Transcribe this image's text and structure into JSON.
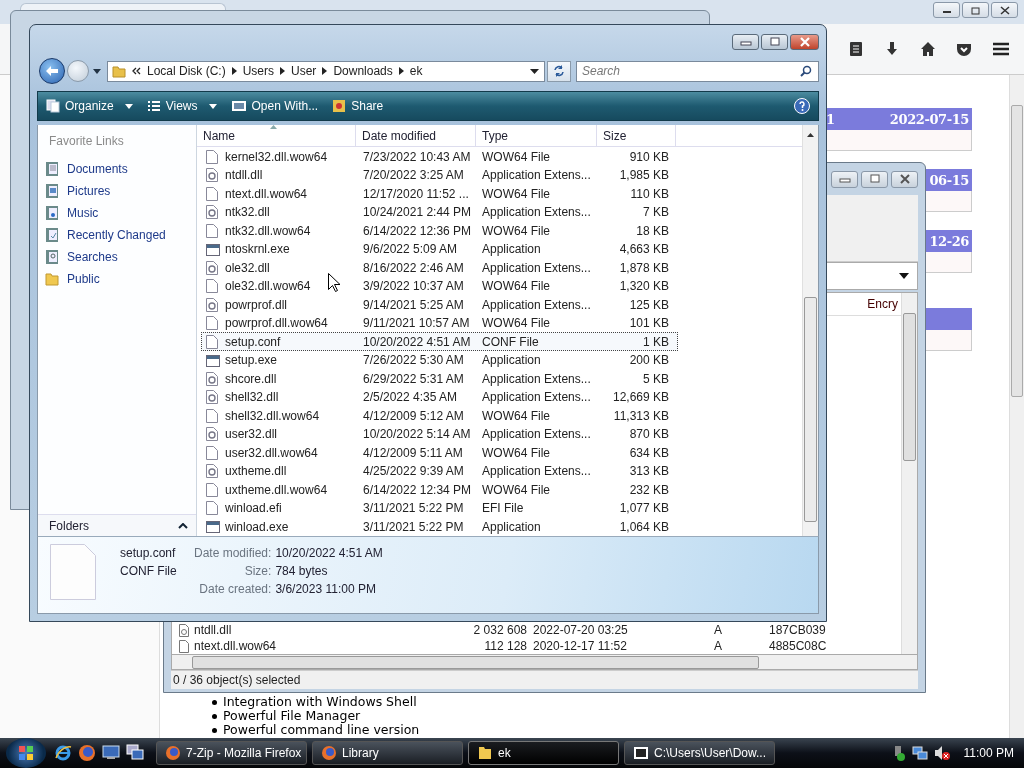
{
  "browser": {
    "page_table": [
      {
        "cells": [
          "1",
          "2022-07-15"
        ]
      },
      {
        "cells": [
          "06-15"
        ]
      },
      {
        "cells": [
          "12-26"
        ]
      }
    ],
    "features": [
      "Integration with Windows Shell",
      "Powerful File Manager",
      "Powerful command line version"
    ]
  },
  "archive_window": {
    "column_header": "Encry",
    "rows": [
      {
        "name": "ntdll.dll",
        "size": "2 032 608",
        "modified": "2022-07-20 03:25",
        "attributes": "A",
        "crc": "187CB039",
        "kind": "dll"
      },
      {
        "name": "ntext.dll.wow64",
        "size": "112 128",
        "modified": "2020-12-17 11:52",
        "attributes": "A",
        "crc": "4885C08C",
        "kind": "file"
      }
    ],
    "status": "0 / 36 object(s) selected"
  },
  "explorer": {
    "breadcrumb": [
      "Local Disk (C:)",
      "Users",
      "User",
      "Downloads",
      "ek"
    ],
    "search": {
      "placeholder": "Search"
    },
    "toolbar": [
      {
        "label": "Organize",
        "kind": "organize",
        "menu": true
      },
      {
        "label": "Views",
        "kind": "views",
        "menu": true
      },
      {
        "label": "Open With...",
        "kind": "open",
        "menu": false
      },
      {
        "label": "Share",
        "kind": "share",
        "menu": false
      }
    ],
    "favorite_links": {
      "title": "Favorite Links",
      "items": [
        {
          "label": "Documents",
          "kind": "documents"
        },
        {
          "label": "Pictures",
          "kind": "pictures"
        },
        {
          "label": "Music",
          "kind": "music"
        },
        {
          "label": "Recently Changed",
          "kind": "recent"
        },
        {
          "label": "Searches",
          "kind": "searches"
        },
        {
          "label": "Public",
          "kind": "folder"
        }
      ]
    },
    "folders_label": "Folders",
    "columns": [
      {
        "label": "Name",
        "sorted": true
      },
      {
        "label": "Date modified",
        "sorted": false
      },
      {
        "label": "Type",
        "sorted": false
      },
      {
        "label": "Size",
        "sorted": false
      }
    ],
    "files": [
      {
        "name": "kernel32.dll.wow64",
        "date": "7/23/2022 10:43 AM",
        "type": "WOW64 File",
        "size": "910 KB",
        "kind": "file",
        "selected": false
      },
      {
        "name": "ntdll.dll",
        "date": "7/20/2022 3:25 AM",
        "type": "Application Extens...",
        "size": "1,985 KB",
        "kind": "dll",
        "selected": false
      },
      {
        "name": "ntext.dll.wow64",
        "date": "12/17/2020 11:52 ...",
        "type": "WOW64 File",
        "size": "110 KB",
        "kind": "file",
        "selected": false
      },
      {
        "name": "ntk32.dll",
        "date": "10/24/2021 2:44 PM",
        "type": "Application Extens...",
        "size": "7 KB",
        "kind": "dll",
        "selected": false
      },
      {
        "name": "ntk32.dll.wow64",
        "date": "6/14/2022 12:36 PM",
        "type": "WOW64 File",
        "size": "18 KB",
        "kind": "file",
        "selected": false
      },
      {
        "name": "ntoskrnl.exe",
        "date": "9/6/2022 5:09 AM",
        "type": "Application",
        "size": "4,663 KB",
        "kind": "exe",
        "selected": false
      },
      {
        "name": "ole32.dll",
        "date": "8/16/2022 2:46 AM",
        "type": "Application Extens...",
        "size": "1,878 KB",
        "kind": "dll",
        "selected": false
      },
      {
        "name": "ole32.dll.wow64",
        "date": "3/9/2022 10:37 AM",
        "type": "WOW64 File",
        "size": "1,320 KB",
        "kind": "file",
        "selected": false
      },
      {
        "name": "powrprof.dll",
        "date": "9/14/2021 5:25 AM",
        "type": "Application Extens...",
        "size": "125 KB",
        "kind": "dll",
        "selected": false
      },
      {
        "name": "powrprof.dll.wow64",
        "date": "9/11/2021 10:57 AM",
        "type": "WOW64 File",
        "size": "101 KB",
        "kind": "file",
        "selected": false
      },
      {
        "name": "setup.conf",
        "date": "10/20/2022 4:51 AM",
        "type": "CONF File",
        "size": "1 KB",
        "kind": "file",
        "selected": true
      },
      {
        "name": "setup.exe",
        "date": "7/26/2022 5:30 AM",
        "type": "Application",
        "size": "200 KB",
        "kind": "exe",
        "selected": false
      },
      {
        "name": "shcore.dll",
        "date": "6/29/2022 5:31 AM",
        "type": "Application Extens...",
        "size": "5 KB",
        "kind": "dll",
        "selected": false
      },
      {
        "name": "shell32.dll",
        "date": "2/5/2022 4:35 AM",
        "type": "Application Extens...",
        "size": "12,669 KB",
        "kind": "dll",
        "selected": false
      },
      {
        "name": "shell32.dll.wow64",
        "date": "4/12/2009 5:12 AM",
        "type": "WOW64 File",
        "size": "11,313 KB",
        "kind": "file",
        "selected": false
      },
      {
        "name": "user32.dll",
        "date": "10/20/2022 5:14 AM",
        "type": "Application Extens...",
        "size": "870 KB",
        "kind": "dll",
        "selected": false
      },
      {
        "name": "user32.dll.wow64",
        "date": "4/12/2009 5:11 AM",
        "type": "WOW64 File",
        "size": "634 KB",
        "kind": "file",
        "selected": false
      },
      {
        "name": "uxtheme.dll",
        "date": "4/25/2022 9:39 AM",
        "type": "Application Extens...",
        "size": "313 KB",
        "kind": "dll",
        "selected": false
      },
      {
        "name": "uxtheme.dll.wow64",
        "date": "6/14/2022 12:34 PM",
        "type": "WOW64 File",
        "size": "232 KB",
        "kind": "file",
        "selected": false
      },
      {
        "name": "winload.efi",
        "date": "3/11/2021 5:22 PM",
        "type": "EFI File",
        "size": "1,077 KB",
        "kind": "file",
        "selected": false
      },
      {
        "name": "winload.exe",
        "date": "3/11/2021 5:22 PM",
        "type": "Application",
        "size": "1,064 KB",
        "kind": "exe",
        "selected": false
      }
    ],
    "details": {
      "name": "setup.conf",
      "type": "CONF File",
      "fields": [
        {
          "label": "Date modified:",
          "value": "10/20/2022 4:51 AM"
        },
        {
          "label": "Size:",
          "value": "784 bytes"
        },
        {
          "label": "Date created:",
          "value": "3/6/2023 11:00 PM"
        }
      ]
    }
  },
  "taskbar": {
    "tasks": [
      {
        "label": "7-Zip - Mozilla Firefox",
        "kind": "browser",
        "selected": false
      },
      {
        "label": "Library",
        "kind": "browser",
        "selected": false
      },
      {
        "label": "ek",
        "kind": "folder",
        "selected": true
      },
      {
        "label": "C:\\Users\\User\\Dow...",
        "kind": "archive",
        "selected": false
      }
    ],
    "clock": "11:00 PM"
  }
}
